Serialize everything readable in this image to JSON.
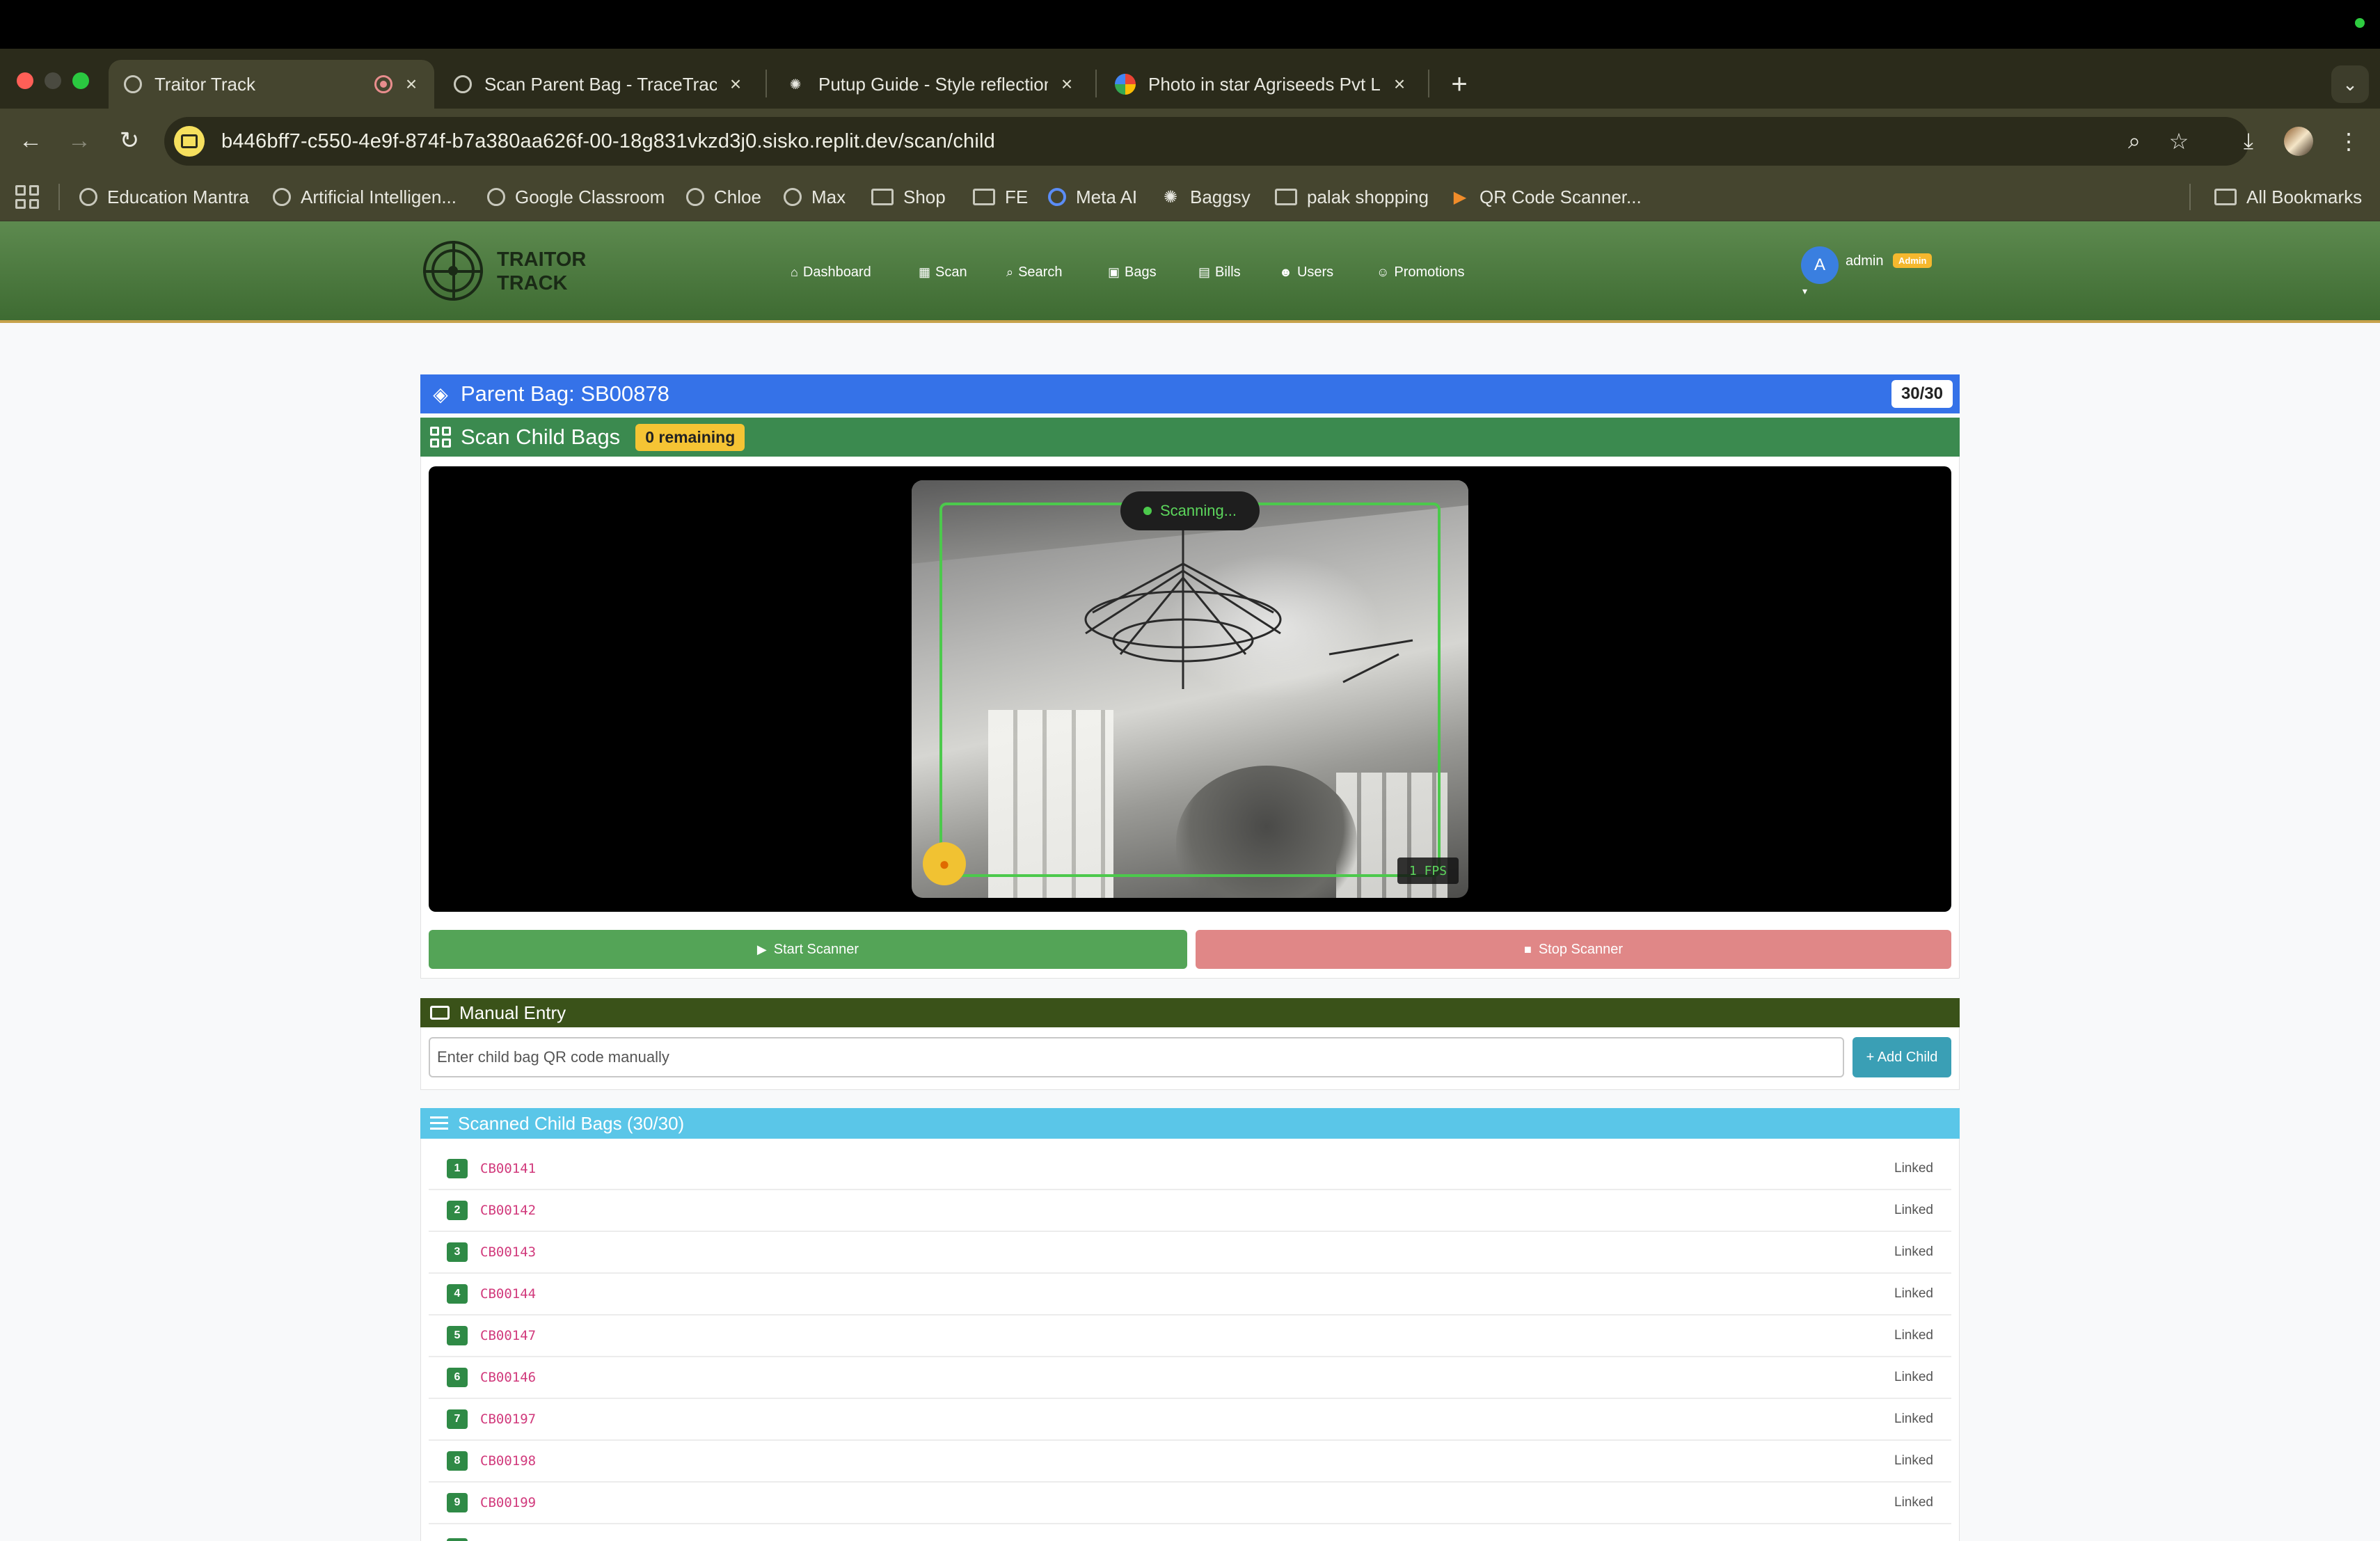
{
  "browser": {
    "tabs": [
      {
        "title": "Traitor Track",
        "active": true,
        "recording": true
      },
      {
        "title": "Scan Parent Bag - TraceTrack",
        "active": false
      },
      {
        "title": "Putup Guide - Style reflection",
        "active": false
      },
      {
        "title": "Photo in star Agriseeds Pvt Lt",
        "active": false
      }
    ],
    "new_tab_icon": "plus-icon",
    "url": "b446bff7-c550-4e9f-874f-b7a380aa626f-00-18g831vkzd3j0.sisko.replit.dev/scan/child",
    "bookmarks": [
      {
        "label": "Education Mantra",
        "icon": "globe"
      },
      {
        "label": "Artificial Intelligen...",
        "icon": "globe"
      },
      {
        "label": "Google Classroom",
        "icon": "globe"
      },
      {
        "label": "Chloe",
        "icon": "globe"
      },
      {
        "label": "Max",
        "icon": "globe"
      },
      {
        "label": "Shop",
        "icon": "folder"
      },
      {
        "label": "FE",
        "icon": "folder"
      },
      {
        "label": "Meta AI",
        "icon": "meta"
      },
      {
        "label": "Baggsy",
        "icon": "openai"
      },
      {
        "label": "palak shopping",
        "icon": "folder"
      },
      {
        "label": "QR Code Scanner...",
        "icon": "play"
      }
    ],
    "all_bookmarks_label": "All Bookmarks"
  },
  "app": {
    "logo_line1": "TRAITOR",
    "logo_line2": "TRACK",
    "nav": [
      {
        "label": "Dashboard",
        "icon": "home-icon"
      },
      {
        "label": "Scan",
        "icon": "qrcode-icon"
      },
      {
        "label": "Search",
        "icon": "search-icon"
      },
      {
        "label": "Bags",
        "icon": "bags-icon"
      },
      {
        "label": "Bills",
        "icon": "bill-icon"
      },
      {
        "label": "Users",
        "icon": "users-icon"
      },
      {
        "label": "Promotions",
        "icon": "user-plus-icon"
      }
    ],
    "user": {
      "initial": "A",
      "name": "admin",
      "role": "Admin"
    }
  },
  "parent_bag": {
    "title": "Parent Bag: SB00878",
    "count": "30/30"
  },
  "scanner": {
    "title": "Scan Child Bags",
    "remaining": "0 remaining",
    "status": "Scanning...",
    "fps": "1 FPS",
    "start_label": "Start Scanner",
    "stop_label": "Stop Scanner"
  },
  "manual_entry": {
    "title": "Manual Entry",
    "placeholder": "Enter child bag QR code manually",
    "add_label": "+ Add Child"
  },
  "scanned_list": {
    "title": "Scanned Child Bags (30/30)",
    "items": [
      {
        "num": "1",
        "code": "CB00141",
        "status": "Linked"
      },
      {
        "num": "2",
        "code": "CB00142",
        "status": "Linked"
      },
      {
        "num": "3",
        "code": "CB00143",
        "status": "Linked"
      },
      {
        "num": "4",
        "code": "CB00144",
        "status": "Linked"
      },
      {
        "num": "5",
        "code": "CB00147",
        "status": "Linked"
      },
      {
        "num": "6",
        "code": "CB00146",
        "status": "Linked"
      },
      {
        "num": "7",
        "code": "CB00197",
        "status": "Linked"
      },
      {
        "num": "8",
        "code": "CB00198",
        "status": "Linked"
      },
      {
        "num": "9",
        "code": "CB00199",
        "status": "Linked"
      }
    ]
  },
  "colors": {
    "primary_blue": "#3572e8",
    "success_green": "#3b8a4f",
    "warning_yellow": "#f5c434",
    "info_cyan": "#5ac6e8",
    "danger_light": "#e08787",
    "code_pink": "#d13a7c"
  }
}
